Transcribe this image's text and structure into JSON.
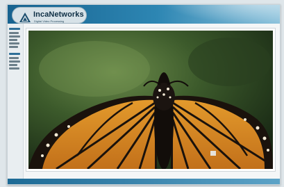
{
  "brand": {
    "name": "IncaNetworks",
    "tagline": "Digital Video Processing"
  },
  "icons": {
    "logo": "inca-triangle-logo-icon"
  },
  "colors": {
    "header_start": "#17628f",
    "header_end": "#8ec3dc",
    "page_background": "#dfe6ea"
  },
  "viewer": {
    "subject": "monarch butterfly"
  }
}
